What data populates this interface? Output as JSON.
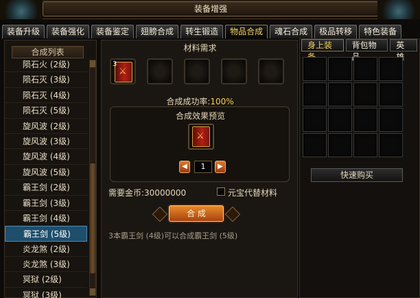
{
  "window": {
    "title": "装备增强"
  },
  "tabs": [
    {
      "label": "装备升级"
    },
    {
      "label": "装备强化"
    },
    {
      "label": "装备鉴定"
    },
    {
      "label": "翅膀合成"
    },
    {
      "label": "转生锻造"
    },
    {
      "label": "物品合成",
      "active": true
    },
    {
      "label": "魂石合成"
    },
    {
      "label": "极品转移"
    },
    {
      "label": "特色装备"
    }
  ],
  "list": {
    "title": "合成列表",
    "items": [
      "陨石火 (2级)",
      "陨石灭 (3级)",
      "陨石灭 (4级)",
      "陨石灭 (5级)",
      "旋风波 (2级)",
      "旋风波 (3级)",
      "旋风波 (4级)",
      "旋风波 (5级)",
      "霸王剑 (2级)",
      "霸王剑 (3级)",
      "霸王剑 (4级)",
      "霸王剑 (5级)",
      "炎龙煞 (2级)",
      "炎龙煞 (3级)",
      "冥狱 (2级)",
      "冥狱 (3级)"
    ],
    "selected_index": 11
  },
  "synthesis": {
    "material_title": "材料需求",
    "material_count": "3",
    "success_label": "合成成功率:",
    "success_rate": "100%",
    "preview_title": "合成效果预览",
    "quantity": "1",
    "prev_arrow": "◀",
    "next_arrow": "▶",
    "gold_label": "需要金币:",
    "gold_value": "30000000",
    "substitute_label": "元宝代替材料",
    "synth_button": "合 成",
    "description": "3本霸王剑 (4级)可以合成霸王剑 (5级)"
  },
  "right_panel": {
    "tabs": [
      {
        "label": "身上装备",
        "active": true
      },
      {
        "label": "背包物品"
      },
      {
        "label": "英雄"
      }
    ],
    "quick_buy": "快速购买"
  }
}
